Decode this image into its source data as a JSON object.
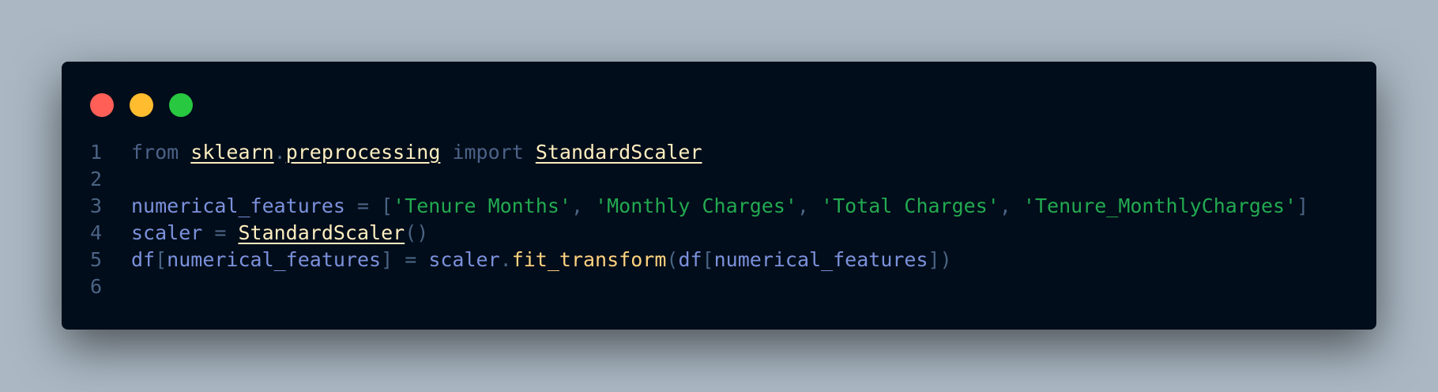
{
  "window": {
    "controls": [
      {
        "name": "close-dot",
        "color": "#ff5f57"
      },
      {
        "name": "minimize-dot",
        "color": "#febc2e"
      },
      {
        "name": "maximize-dot",
        "color": "#28c840"
      }
    ]
  },
  "code": {
    "lines": [
      {
        "number": "1",
        "tokens": [
          {
            "text": "from",
            "type": "kw"
          },
          {
            "text": " ",
            "type": "punc"
          },
          {
            "text": "sklearn",
            "type": "mod"
          },
          {
            "text": ".",
            "type": "punc"
          },
          {
            "text": "preprocessing",
            "type": "mod"
          },
          {
            "text": " ",
            "type": "punc"
          },
          {
            "text": "import",
            "type": "kw"
          },
          {
            "text": " ",
            "type": "punc"
          },
          {
            "text": "StandardScaler",
            "type": "mod"
          }
        ]
      },
      {
        "number": "2",
        "tokens": []
      },
      {
        "number": "3",
        "tokens": [
          {
            "text": "numerical_features",
            "type": "var"
          },
          {
            "text": " = [",
            "type": "punc"
          },
          {
            "text": "'Tenure Months'",
            "type": "str"
          },
          {
            "text": ", ",
            "type": "punc"
          },
          {
            "text": "'Monthly Charges'",
            "type": "str"
          },
          {
            "text": ", ",
            "type": "punc"
          },
          {
            "text": "'Total Charges'",
            "type": "str"
          },
          {
            "text": ", ",
            "type": "punc"
          },
          {
            "text": "'Tenure_MonthlyCharges'",
            "type": "str"
          },
          {
            "text": "]",
            "type": "punc"
          }
        ]
      },
      {
        "number": "4",
        "tokens": [
          {
            "text": "scaler",
            "type": "var"
          },
          {
            "text": " = ",
            "type": "punc"
          },
          {
            "text": "StandardScaler",
            "type": "mod"
          },
          {
            "text": "()",
            "type": "punc"
          }
        ]
      },
      {
        "number": "5",
        "tokens": [
          {
            "text": "df",
            "type": "var"
          },
          {
            "text": "[",
            "type": "punc"
          },
          {
            "text": "numerical_features",
            "type": "var"
          },
          {
            "text": "] = ",
            "type": "punc"
          },
          {
            "text": "scaler",
            "type": "var"
          },
          {
            "text": ".",
            "type": "punc"
          },
          {
            "text": "fit_transform",
            "type": "fn"
          },
          {
            "text": "(",
            "type": "punc"
          },
          {
            "text": "df",
            "type": "var"
          },
          {
            "text": "[",
            "type": "punc"
          },
          {
            "text": "numerical_features",
            "type": "var"
          },
          {
            "text": "])",
            "type": "punc"
          }
        ]
      },
      {
        "number": "6",
        "tokens": []
      }
    ]
  }
}
